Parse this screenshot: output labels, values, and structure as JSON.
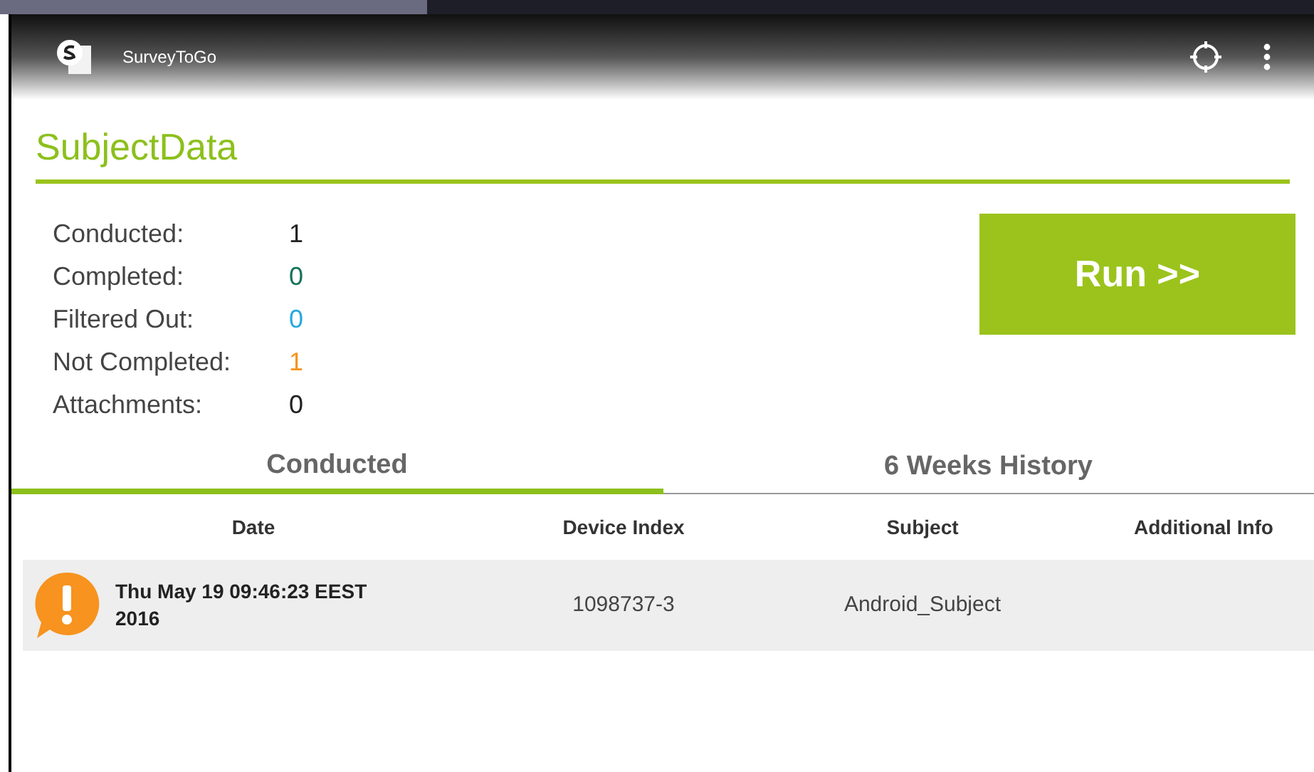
{
  "app_bar": {
    "title": "SurveyToGo"
  },
  "page_title": "SubjectData",
  "stats": [
    {
      "label": "Conducted:",
      "value": "1",
      "color": "#222222"
    },
    {
      "label": "Completed:",
      "value": "0",
      "color": "#17735a"
    },
    {
      "label": "Filtered Out:",
      "value": "0",
      "color": "#29a9e0"
    },
    {
      "label": "Not Completed:",
      "value": "1",
      "color": "#f7931e"
    },
    {
      "label": "Attachments:",
      "value": "0",
      "color": "#222222"
    }
  ],
  "run_button": "Run >>",
  "tabs": [
    {
      "label": "Conducted",
      "selected": true
    },
    {
      "label": "6 Weeks History",
      "selected": false
    }
  ],
  "table": {
    "columns": [
      "Date",
      "Device Index",
      "Subject",
      "Additional Info"
    ],
    "rows": [
      {
        "date": "Thu May 19 09:46:23 EEST 2016",
        "device_index": "1098737-3",
        "subject": "Android_Subject"
      }
    ]
  }
}
